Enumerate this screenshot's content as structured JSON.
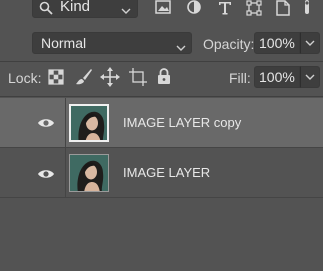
{
  "filter": {
    "kind_label": "Kind",
    "filter_icons": [
      "image-filter-icon",
      "adjustment-filter-icon",
      "type-filter-icon",
      "shape-filter-icon",
      "smart-object-filter-icon"
    ]
  },
  "blend": {
    "mode": "Normal",
    "opacity_label": "Opacity:",
    "opacity_value": "100%"
  },
  "lock": {
    "label": "Lock:",
    "icons": [
      "lock-transparent-pixels-icon",
      "lock-image-pixels-icon",
      "lock-position-icon",
      "lock-artboard-icon",
      "lock-all-icon"
    ],
    "fill_label": "Fill:",
    "fill_value": "100%"
  },
  "layers": [
    {
      "name": "IMAGE LAYER copy",
      "visible": true,
      "selected": true
    },
    {
      "name": "IMAGE LAYER",
      "visible": true,
      "selected": false
    }
  ],
  "colors": {
    "panel_bg": "#535353",
    "selected_row": "#696969",
    "field_bg": "#3e3e3e"
  }
}
